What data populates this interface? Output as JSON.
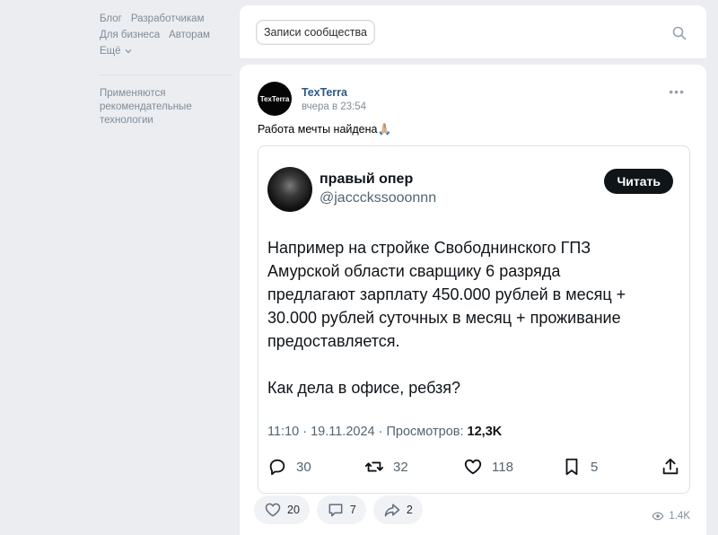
{
  "sidebar": {
    "links_row1": [
      "Блог",
      "Разработчикам"
    ],
    "links_row2": [
      "Для бизнеса",
      "Авторам"
    ],
    "more_label": "Ещё",
    "recommend_text": "Применяются рекомендательные технологии"
  },
  "feed": {
    "tab_label": "Записи сообщества"
  },
  "post": {
    "author_name": "TexTerra",
    "logo_text": "TexTerra",
    "time": "вчера в 23:54",
    "text": "Работа мечты найдена🙏🏼",
    "tweet": {
      "name": "правый опер",
      "handle": "@jaccckssooonnn",
      "read_button": "Читать",
      "body_lines": [
        "Например на стройке Свободнинского ГПЗ",
        "Амурской области сварщику 6 разряда",
        "предлагают зарплату 450.000 рублей в месяц +",
        "30.000 рублей суточных в месяц + проживание",
        "предоставляется."
      ],
      "body_tail": "Как дела в офисе, ребзя?",
      "meta_prefix": "11:10 · 19.11.2024 · Просмотров:",
      "meta_views": "12,3K",
      "replies": "30",
      "retweets": "32",
      "likes": "118",
      "bookmarks": "5"
    },
    "likes": "20",
    "comments": "7",
    "shares": "2",
    "views": "1.4K"
  }
}
